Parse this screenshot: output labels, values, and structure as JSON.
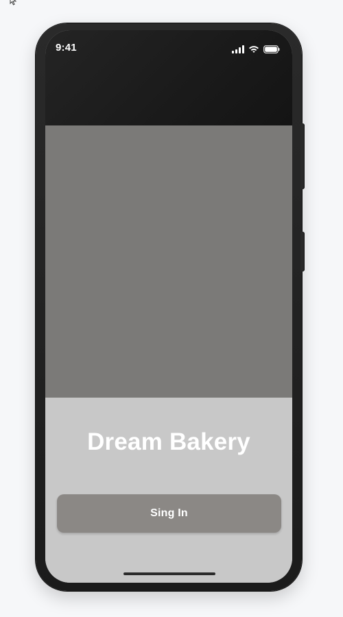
{
  "status_bar": {
    "time": "9:41",
    "icons": [
      "cellular-signal-icon",
      "wifi-icon",
      "battery-icon"
    ]
  },
  "app": {
    "title": "Dream Bakery",
    "primary_button_label": "Sing In"
  },
  "colors": {
    "page_background": "#f6f7f9",
    "phone_frame": "#1f1f1f",
    "status_region": "#1d1d1d",
    "hero": "#7b7a78",
    "content_background": "#c8c8c8",
    "button_background": "#8b8885",
    "text_light": "#ffffff",
    "home_indicator": "#2b2b2b"
  }
}
